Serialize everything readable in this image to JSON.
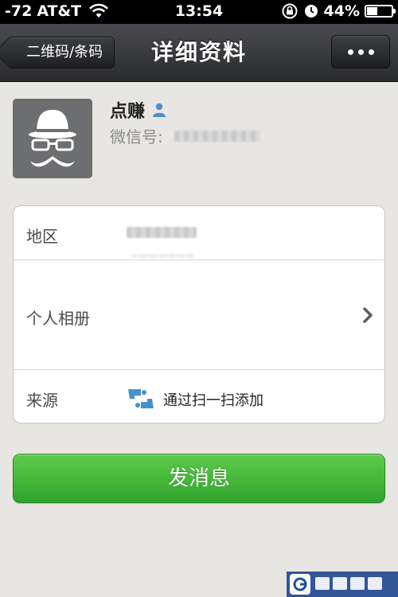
{
  "status_bar": {
    "signal": "-72",
    "carrier": "AT&T",
    "time": "13:54",
    "battery": "44%",
    "battery_level": 0.44
  },
  "nav": {
    "back_label": "二维码/条码",
    "title": "详细资料",
    "more_icon": "more-dots-icon"
  },
  "profile": {
    "name": "点赚",
    "wechat_id_label": "微信号:"
  },
  "info": {
    "region_label": "地区",
    "album_label": "个人相册",
    "source_label": "来源",
    "source_value": "通过扫一扫添加"
  },
  "actions": {
    "send_message_label": "发消息"
  },
  "colors": {
    "accent_green": "#3cb83a",
    "nav_dark": "#2a2b2d",
    "background": "#e8e6e3"
  }
}
